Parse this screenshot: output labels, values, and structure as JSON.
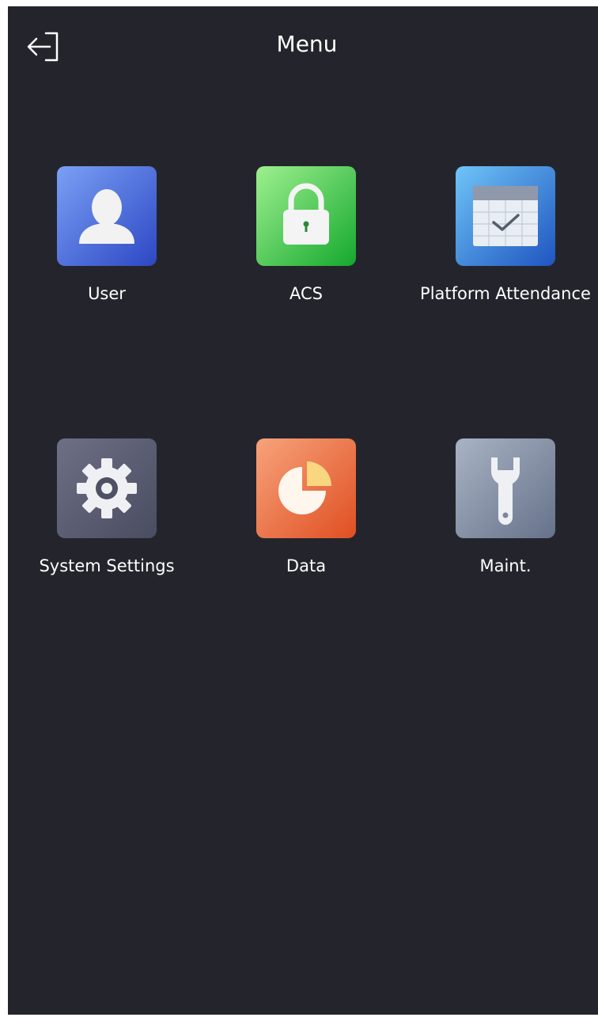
{
  "header": {
    "title": "Menu",
    "exit_icon": "exit-arrow-icon"
  },
  "menu": {
    "items": [
      {
        "label": "User",
        "icon": "user-icon"
      },
      {
        "label": "ACS",
        "icon": "padlock-icon"
      },
      {
        "label": "Platform Attendance",
        "icon": "calendar-check-icon"
      },
      {
        "label": "System Settings",
        "icon": "gear-icon"
      },
      {
        "label": "Data",
        "icon": "pie-chart-icon"
      },
      {
        "label": "Maint.",
        "icon": "wrench-icon"
      }
    ]
  },
  "colors": {
    "background": "#24252c",
    "text": "#ffffff",
    "user_tile": "#3f63d6",
    "acs_tile": "#32b84b",
    "attendance_tile": "#2f7fd6",
    "settings_tile": "#5b5d73",
    "data_tile": "#ee7a45",
    "maint_tile": "#7f8aa0"
  }
}
